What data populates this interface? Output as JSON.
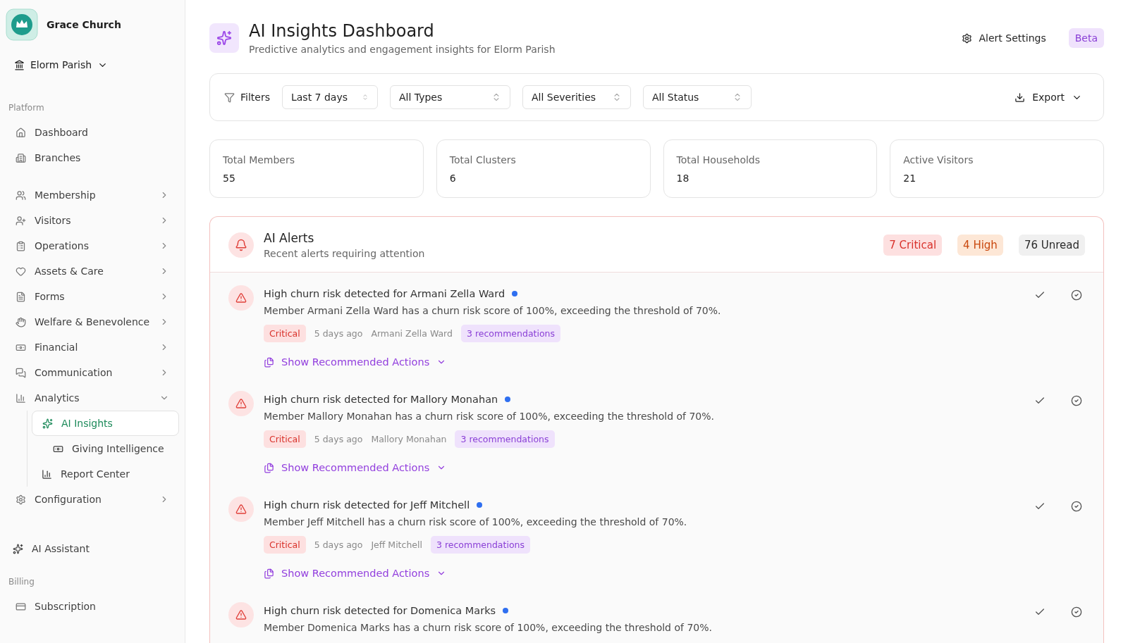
{
  "sidebar": {
    "org": "Grace Church",
    "parish": "Elorm Parish",
    "sections": [
      {
        "label": "Platform",
        "items": [
          {
            "label": "Dashboard",
            "selected": false
          },
          {
            "label": "Branches",
            "selected": false
          },
          {
            "label": "Membership",
            "expanded": false,
            "selected": false
          },
          {
            "label": "Visitors",
            "expanded": false,
            "selected": false
          },
          {
            "label": "Operations",
            "expanded": false,
            "selected": false
          },
          {
            "label": "Assets & Care",
            "expanded": false,
            "selected": false
          },
          {
            "label": "Forms",
            "expanded": false,
            "selected": false
          },
          {
            "label": "Welfare & Benevolence",
            "expanded": false,
            "selected": false
          },
          {
            "label": "Financial",
            "expanded": false,
            "selected": false
          },
          {
            "label": "Communication",
            "expanded": false,
            "selected": false
          },
          {
            "label": "Analytics",
            "expanded": true,
            "selected": false,
            "children": [
              {
                "label": "AI Insights",
                "selected": true,
                "children": [
                  {
                    "label": "Giving Intelligence",
                    "selected": false
                  }
                ]
              },
              {
                "label": "Report Center",
                "selected": false
              }
            ]
          },
          {
            "label": "Configuration",
            "expanded": false,
            "selected": false
          }
        ]
      }
    ],
    "assistant": "AI Assistant",
    "billing": {
      "label": "Billing",
      "items": [
        {
          "label": "Subscription",
          "selected": false
        }
      ]
    }
  },
  "header": {
    "title": "AI Insights Dashboard",
    "subtitle": "Predictive analytics and engagement insights for Elorm Parish",
    "settings": "Alert Settings",
    "badge": "Beta"
  },
  "filters": {
    "label": "Filters",
    "selects": [
      "Last 7 days",
      "All Types",
      "All Severities",
      "All Status"
    ],
    "export": "Export"
  },
  "stats": [
    {
      "label": "Total Members",
      "value": "55"
    },
    {
      "label": "Total Clusters",
      "value": "6"
    },
    {
      "label": "Total Households",
      "value": "18"
    },
    {
      "label": "Active Visitors",
      "value": "21"
    }
  ],
  "alerts": {
    "title": "AI Alerts",
    "subtitle": "Recent alerts requiring attention",
    "counts": [
      {
        "label": "7 Critical",
        "kind": "critical"
      },
      {
        "label": "4 High",
        "kind": "high"
      },
      {
        "label": "76 Unread",
        "kind": "unread"
      }
    ],
    "items": [
      {
        "title": "High churn risk detected for Armani Zella Ward",
        "unread": true,
        "text": "Member Armani Zella Ward has a churn risk score of 100%, exceeding the threshold of 70%.",
        "severity": "Critical",
        "time": "5 days ago",
        "member": "Armani Zella Ward",
        "recs": "3 recommendations",
        "action": "Show Recommended Actions"
      },
      {
        "title": "High churn risk detected for Mallory Monahan",
        "unread": true,
        "text": "Member Mallory Monahan has a churn risk score of 100%, exceeding the threshold of 70%.",
        "severity": "Critical",
        "time": "5 days ago",
        "member": "Mallory Monahan",
        "recs": "3 recommendations",
        "action": "Show Recommended Actions"
      },
      {
        "title": "High churn risk detected for Jeff Mitchell",
        "unread": true,
        "text": "Member Jeff Mitchell has a churn risk score of 100%, exceeding the threshold of 70%.",
        "severity": "Critical",
        "time": "5 days ago",
        "member": "Jeff Mitchell",
        "recs": "3 recommendations",
        "action": "Show Recommended Actions"
      },
      {
        "title": "High churn risk detected for Domenica Marks",
        "unread": true,
        "text": "Member Domenica Marks has a churn risk score of 100%, exceeding the threshold of 70%."
      }
    ]
  }
}
